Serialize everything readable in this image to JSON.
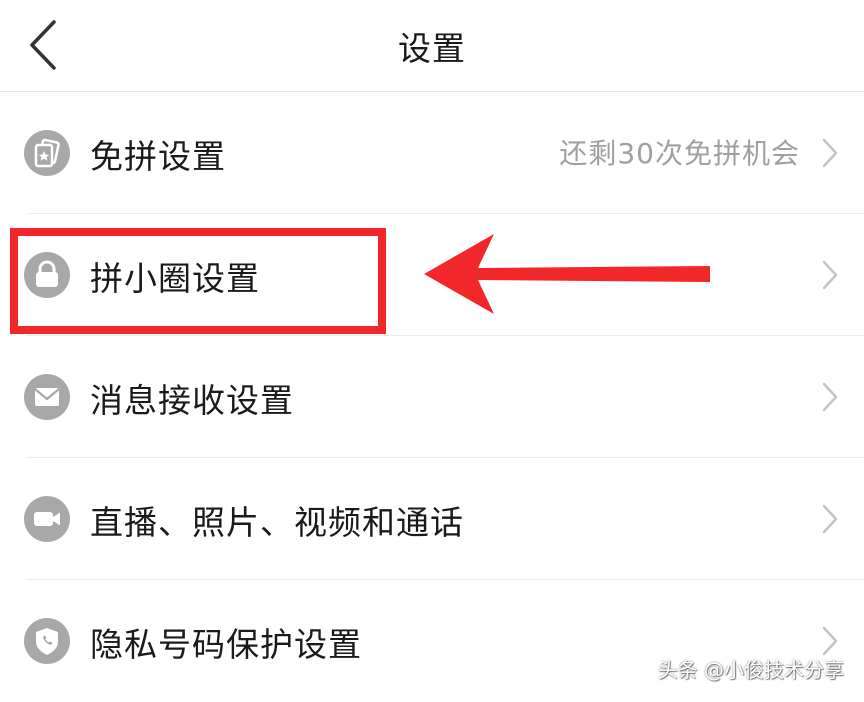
{
  "header": {
    "title": "设置"
  },
  "settings": {
    "items": [
      {
        "label": "免拼设置",
        "value": "还剩30次免拼机会",
        "icon": "free-group-card-icon"
      },
      {
        "label": "拼小圈设置",
        "value": "",
        "icon": "lock-icon"
      },
      {
        "label": "消息接收设置",
        "value": "",
        "icon": "envelope-icon"
      },
      {
        "label": "直播、照片、视频和通话",
        "value": "",
        "icon": "video-camera-icon"
      },
      {
        "label": "隐私号码保护设置",
        "value": "",
        "icon": "shield-phone-icon"
      }
    ]
  },
  "annotation": {
    "highlight_color": "#f2272a"
  },
  "watermark": {
    "text": "头条 @小俊技术分享"
  },
  "colors": {
    "icon_gray": "#a8a8a8",
    "text": "#1a1a1a",
    "secondary_text": "#a0a0a0"
  }
}
